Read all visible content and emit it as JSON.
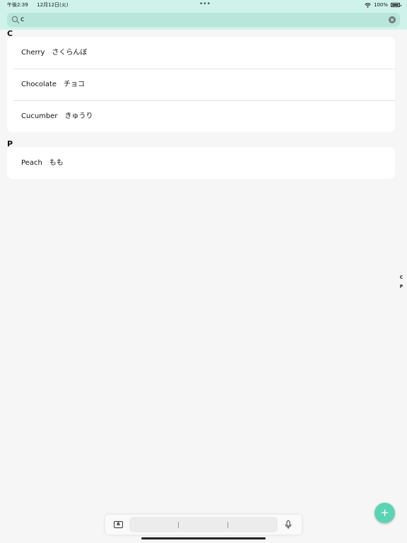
{
  "status_bar": {
    "time": "午後2:39",
    "date": "12月12日(火)",
    "dots": "•••",
    "battery": "100%"
  },
  "search": {
    "value": "c",
    "icon": "search-icon",
    "clear_icon": "clear-icon"
  },
  "sections": [
    {
      "header": "C",
      "items": [
        {
          "label": "Cherry　さくらんぼ"
        },
        {
          "label": "Chocolate　チョコ"
        },
        {
          "label": "Cucumber　きゅうり"
        }
      ]
    },
    {
      "header": "P",
      "items": [
        {
          "label": "Peach　もも"
        }
      ]
    }
  ],
  "index_bar": [
    "C",
    "P"
  ],
  "fab": {
    "label": "+",
    "color": "#5cd3b4"
  },
  "keyboard_bar": {
    "a_label": "A"
  },
  "colors": {
    "accent": "#5cd3b4",
    "header_bg": "#cff3ea",
    "search_bg": "#b9e6da"
  }
}
